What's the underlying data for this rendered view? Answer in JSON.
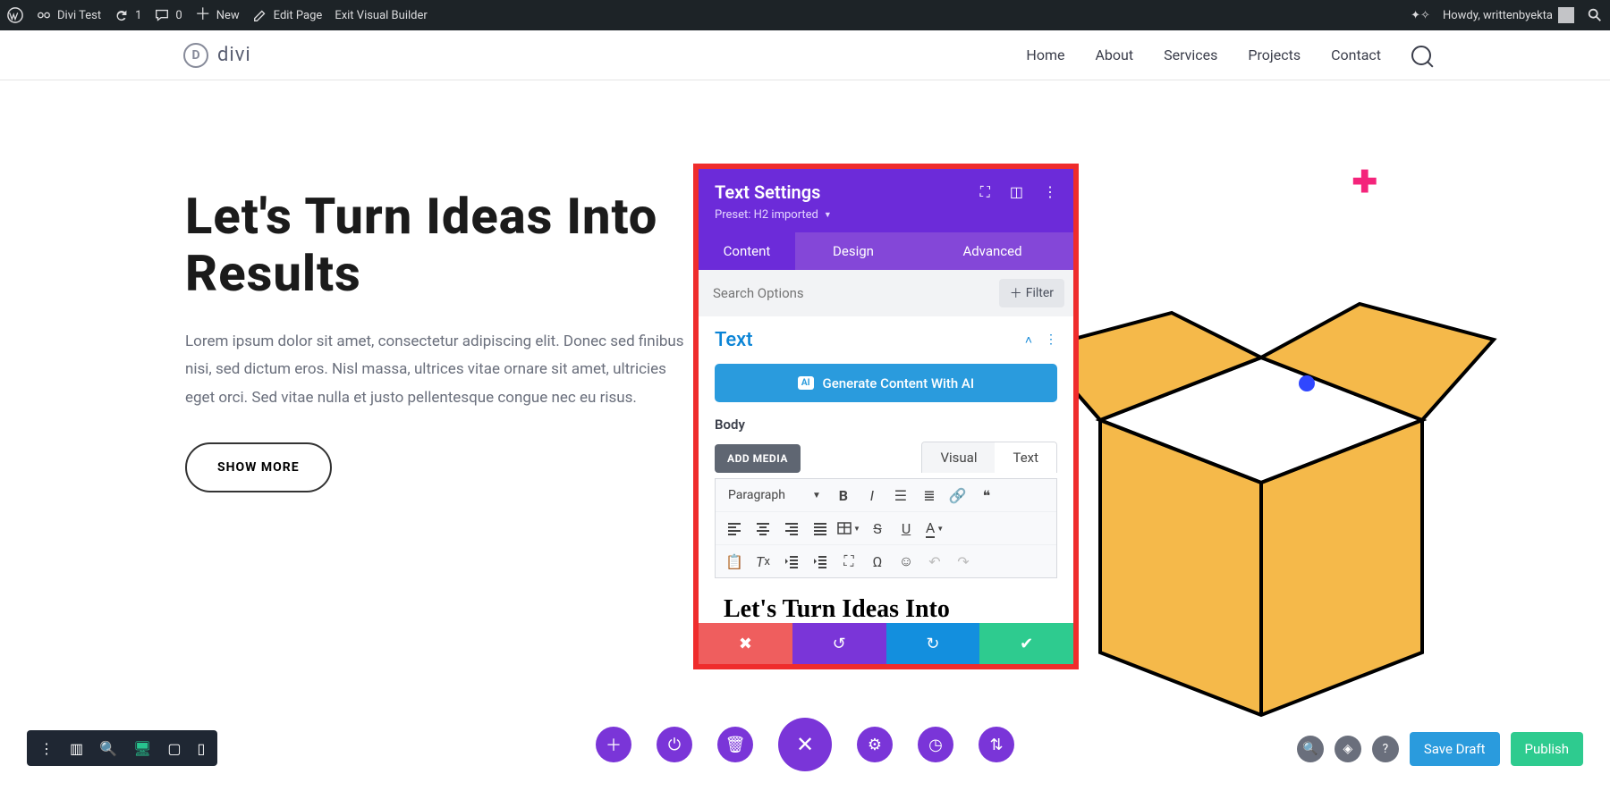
{
  "adminbar": {
    "site": "Divi Test",
    "updates": "1",
    "comments": "0",
    "new": "New",
    "edit": "Edit Page",
    "exit": "Exit Visual Builder",
    "howdy": "Howdy, writtenbyekta"
  },
  "header": {
    "logo": "divi",
    "nav": {
      "home": "Home",
      "about": "About",
      "services": "Services",
      "projects": "Projects",
      "contact": "Contact"
    }
  },
  "hero": {
    "title": "Let's Turn Ideas Into Results",
    "body": "Lorem ipsum dolor sit amet, consectetur adipiscing elit. Donec sed finibus nisi, sed dictum eros. Nisl massa, ultrices vitae ornare sit amet, ultricies eget orci. Sed vitae nulla et justo pellentesque congue nec eu risus.",
    "cta": "SHOW MORE"
  },
  "panel": {
    "title": "Text Settings",
    "preset": "Preset: H2 imported",
    "tabs": {
      "content": "Content",
      "design": "Design",
      "advanced": "Advanced"
    },
    "search_placeholder": "Search Options",
    "filter": "Filter",
    "group_title": "Text",
    "ai_button": "Generate Content With AI",
    "ai_badge": "AI",
    "body_label": "Body",
    "add_media": "ADD MEDIA",
    "visual_tab": "Visual",
    "text_tab": "Text",
    "paragraph": "Paragraph",
    "editor_preview": "Let's Turn Ideas Into"
  },
  "bottom": {
    "save": "Save Draft",
    "publish": "Publish"
  }
}
